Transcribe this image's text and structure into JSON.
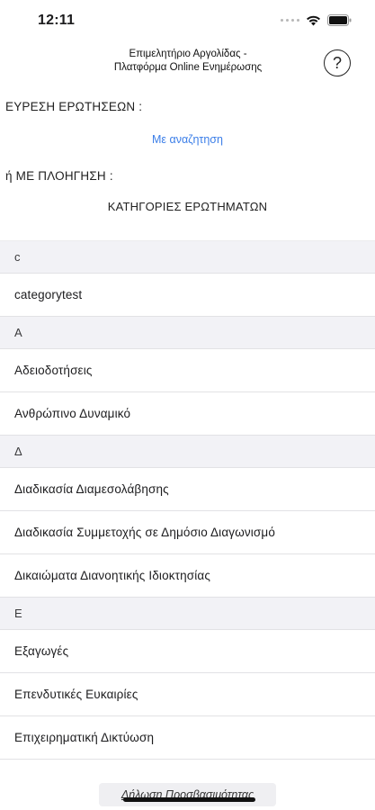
{
  "status_bar": {
    "time": "12:11"
  },
  "nav": {
    "title_line1": "Επιμελητήριο Αργολίδας -",
    "title_line2": "Πλατφόρμα Online Ενημέρωσης",
    "help_label": "?"
  },
  "search": {
    "find_label": "ΕΥΡΕΣΗ ΕΡΩΤΗΣΕΩΝ :",
    "search_link": "Με αναζητηση",
    "browse_label": "ή ΜΕ ΠΛΟΗΓΗΣΗ :",
    "categories_title": "ΚΑΤΗΓΟΡΙΕΣ ΕΡΩΤΗΜΑΤΩΝ"
  },
  "list": {
    "rows": [
      {
        "type": "spacer",
        "label": ""
      },
      {
        "type": "section",
        "label": "c"
      },
      {
        "type": "item",
        "label": "categorytest"
      },
      {
        "type": "section",
        "label": "Α"
      },
      {
        "type": "item",
        "label": "Αδειοδοτήσεις"
      },
      {
        "type": "item",
        "label": "Ανθρώπινο Δυναμικό"
      },
      {
        "type": "section",
        "label": "Δ"
      },
      {
        "type": "item",
        "label": "Διαδικασία Διαμεσολάβησης"
      },
      {
        "type": "item",
        "label": "Διαδικασία Συμμετοχής σε Δημόσιο Διαγωνισμό"
      },
      {
        "type": "item",
        "label": "Δικαιώματα Διανοητικής Ιδιοκτησίας"
      },
      {
        "type": "section",
        "label": "Ε"
      },
      {
        "type": "item",
        "label": "Εξαγωγές"
      },
      {
        "type": "item",
        "label": "Επενδυτικές Ευκαιρίες"
      },
      {
        "type": "item",
        "label": "Επιχειρηματική Δικτύωση"
      }
    ]
  },
  "footer": {
    "accessibility_link": "Δήλωση Προσβασιμότητας"
  },
  "colors": {
    "link": "#3b7ee8",
    "section_bg": "#f2f2f6",
    "separator": "#e2e2e5"
  }
}
